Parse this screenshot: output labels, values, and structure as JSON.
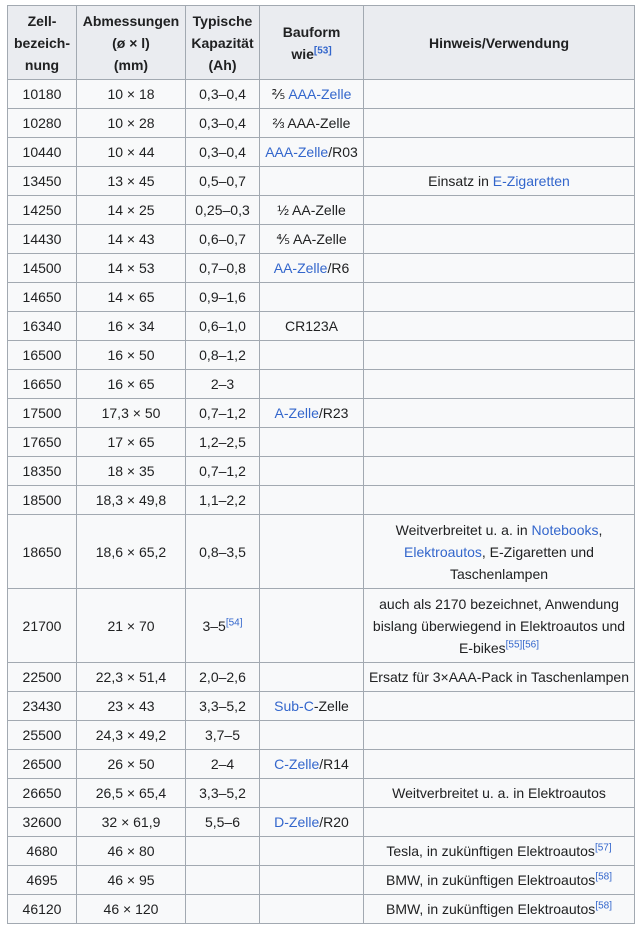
{
  "table": {
    "headers": {
      "col1": [
        "Zell-",
        "bezeich-",
        "nung"
      ],
      "col2": [
        "Abmessungen",
        "(ø × l)",
        "(mm)"
      ],
      "col3": [
        "Typische",
        "Kapazität",
        "(Ah)"
      ],
      "col4_text": "Bauform",
      "col4_text2": "wie",
      "col4_ref": "[53]",
      "col5": "Hinweis/Verwendung"
    },
    "rows": [
      {
        "id": "10180",
        "dim": "10 × 18",
        "cap": "0,3–0,4",
        "form_link": "AAA-Zelle",
        "form_pre": "⅖ ",
        "form_post": "",
        "note": ""
      },
      {
        "id": "10280",
        "dim": "10 × 28",
        "cap": "0,3–0,4",
        "form_link": "",
        "form_pre": "⅔ AAA-Zelle",
        "form_post": "",
        "note": ""
      },
      {
        "id": "10440",
        "dim": "10 × 44",
        "cap": "0,3–0,4",
        "form_link": "AAA-Zelle",
        "form_pre": "",
        "form_post": "/R03",
        "note": ""
      },
      {
        "id": "13450",
        "dim": "13 × 45",
        "cap": "0,5–0,7",
        "form_link": "",
        "form_pre": "",
        "form_post": "",
        "note_pre": "Einsatz in ",
        "note_link": "E-Zigaretten"
      },
      {
        "id": "14250",
        "dim": "14 × 25",
        "cap": "0,25–0,3",
        "form_link": "",
        "form_pre": "½ AA-Zelle",
        "form_post": "",
        "note": ""
      },
      {
        "id": "14430",
        "dim": "14 × 43",
        "cap": "0,6–0,7",
        "form_link": "",
        "form_pre": "⅘ AA-Zelle",
        "form_post": "",
        "note": ""
      },
      {
        "id": "14500",
        "dim": "14 × 53",
        "cap": "0,7–0,8",
        "form_link": "AA-Zelle",
        "form_pre": "",
        "form_post": "/R6",
        "note": ""
      },
      {
        "id": "14650",
        "dim": "14 × 65",
        "cap": "0,9–1,6",
        "form_link": "",
        "form_pre": "",
        "form_post": "",
        "note": ""
      },
      {
        "id": "16340",
        "dim": "16 × 34",
        "cap": "0,6–1,0",
        "form_link": "",
        "form_pre": "CR123A",
        "form_post": "",
        "note": ""
      },
      {
        "id": "16500",
        "dim": "16 × 50",
        "cap": "0,8–1,2",
        "form_link": "",
        "form_pre": "",
        "form_post": "",
        "note": ""
      },
      {
        "id": "16650",
        "dim": "16 × 65",
        "cap": "2–3",
        "form_link": "",
        "form_pre": "",
        "form_post": "",
        "note": ""
      },
      {
        "id": "17500",
        "dim": "17,3 × 50",
        "cap": "0,7–1,2",
        "form_link": "A-Zelle",
        "form_pre": "",
        "form_post": "/R23",
        "note": ""
      },
      {
        "id": "17650",
        "dim": "17 × 65",
        "cap": "1,2–2,5",
        "form_link": "",
        "form_pre": "",
        "form_post": "",
        "note": ""
      },
      {
        "id": "18350",
        "dim": "18 × 35",
        "cap": "0,7–1,2",
        "form_link": "",
        "form_pre": "",
        "form_post": "",
        "note": ""
      },
      {
        "id": "18500",
        "dim": "18,3 × 49,8",
        "cap": "1,1–2,2",
        "form_link": "",
        "form_pre": "",
        "form_post": "",
        "note": ""
      }
    ],
    "row18650": {
      "id": "18650",
      "dim": "18,6 × 65,2",
      "cap": "0,8–3,5",
      "note_l1_pre": "Weitverbreitet u. a. in ",
      "note_l1_link": "Notebooks",
      ",": ",",
      "note_l2_link": "Elektroautos",
      "note_l2_post": ", E-Zigaretten und",
      "note_l3": "Taschenlampen"
    },
    "row21700": {
      "id": "21700",
      "dim": "21 × 70",
      "cap": "3–5",
      "cap_ref": "[54]",
      "note_l1": "auch als 2170 bezeichnet, Anwendung",
      "note_l2": "bislang überwiegend in Elektroautos und",
      "note_l3": "E-bikes",
      "note_ref1": "[55]",
      "note_ref2": "[56]"
    },
    "rows2": [
      {
        "id": "22500",
        "dim": "22,3 × 51,4",
        "cap": "2,0–2,6",
        "form_link": "",
        "form_pre": "",
        "form_post": "",
        "note": "Ersatz für 3×AAA-Pack in Taschenlampen",
        "note_ref": ""
      },
      {
        "id": "23430",
        "dim": "23 × 43",
        "cap": "3,3–5,2",
        "form_link": "Sub-C",
        "form_pre": "",
        "form_post": "-Zelle",
        "note": "",
        "note_ref": ""
      },
      {
        "id": "25500",
        "dim": "24,3 × 49,2",
        "cap": "3,7–5",
        "form_link": "",
        "form_pre": "",
        "form_post": "",
        "note": "",
        "note_ref": ""
      },
      {
        "id": "26500",
        "dim": "26 × 50",
        "cap": "2–4",
        "form_link": "C-Zelle",
        "form_pre": "",
        "form_post": "/R14",
        "note": "",
        "note_ref": ""
      },
      {
        "id": "26650",
        "dim": "26,5 × 65,4",
        "cap": "3,3–5,2",
        "form_link": "",
        "form_pre": "",
        "form_post": "",
        "note": "Weitverbreitet u. a. in Elektroautos",
        "note_ref": ""
      },
      {
        "id": "32600",
        "dim": "32 × 61,9",
        "cap": "5,5–6",
        "form_link": "D-Zelle",
        "form_pre": "",
        "form_post": "/R20",
        "note": "",
        "note_ref": ""
      },
      {
        "id": "4680",
        "dim": "46 × 80",
        "cap": "",
        "form_link": "",
        "form_pre": "",
        "form_post": "",
        "note": "Tesla, in zukünftigen Elektroautos",
        "note_ref": "[57]"
      },
      {
        "id": "4695",
        "dim": "46 × 95",
        "cap": "",
        "form_link": "",
        "form_pre": "",
        "form_post": "",
        "note": "BMW, in zukünftigen Elektroautos",
        "note_ref": "[58]"
      },
      {
        "id": "46120",
        "dim": "46 × 120",
        "cap": "",
        "form_link": "",
        "form_pre": "",
        "form_post": "",
        "note": "BMW, in zukünftigen Elektroautos",
        "note_ref": "[58]"
      }
    ]
  },
  "colors": {
    "link": "#3366cc",
    "header_bg": "#eaecf0",
    "cell_bg": "#f8f9fa",
    "border": "#a2a9b1"
  }
}
